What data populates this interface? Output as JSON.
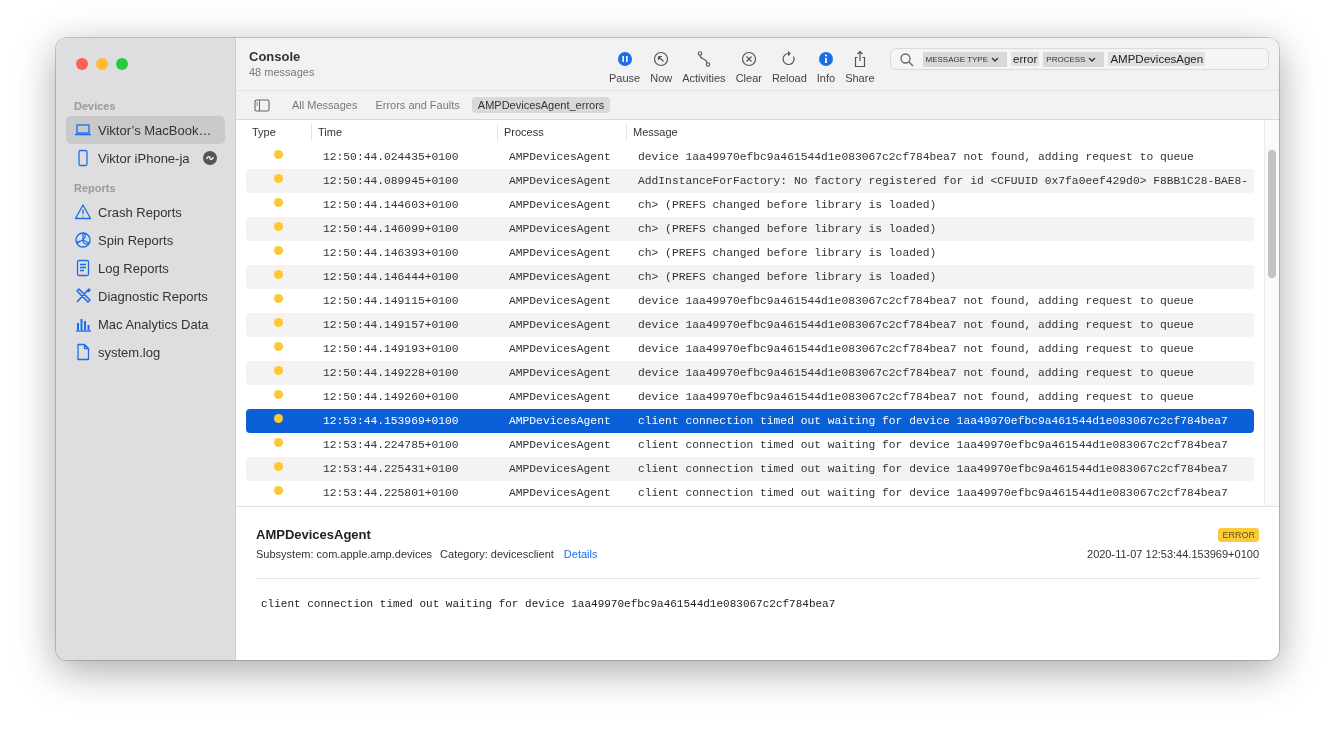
{
  "window": {
    "title": "Console",
    "subtitle": "48 messages"
  },
  "sidebar": {
    "sections": [
      {
        "heading": "Devices",
        "items": [
          {
            "label": "Viktor’s MacBook…",
            "kind": "laptop",
            "selected": true,
            "badge": false
          },
          {
            "label": "Viktor iPhone-ja",
            "kind": "phone",
            "selected": false,
            "badge": true
          }
        ]
      },
      {
        "heading": "Reports",
        "items": [
          {
            "label": "Crash Reports",
            "kind": "warning",
            "selected": false,
            "badge": false
          },
          {
            "label": "Spin Reports",
            "kind": "spin",
            "selected": false,
            "badge": false
          },
          {
            "label": "Log Reports",
            "kind": "doclines",
            "selected": false,
            "badge": false
          },
          {
            "label": "Diagnostic Reports",
            "kind": "tools",
            "selected": false,
            "badge": false
          },
          {
            "label": "Mac Analytics Data",
            "kind": "bars",
            "selected": false,
            "badge": false
          },
          {
            "label": "system.log",
            "kind": "doc",
            "selected": false,
            "badge": false
          }
        ]
      }
    ]
  },
  "toolbar": [
    {
      "label": "Pause",
      "kind": "pause"
    },
    {
      "label": "Now",
      "kind": "now"
    },
    {
      "label": "Activities",
      "kind": "activities"
    },
    {
      "label": "Clear",
      "kind": "clear"
    },
    {
      "label": "Reload",
      "kind": "reload"
    },
    {
      "label": "Info",
      "kind": "info"
    },
    {
      "label": "Share",
      "kind": "share"
    }
  ],
  "search": {
    "tokens": [
      {
        "key": "MESSAGE TYPE",
        "value": "error"
      },
      {
        "key": "PROCESS",
        "value": "AMPDevicesAgen"
      }
    ]
  },
  "tabs": [
    {
      "label": "All Messages",
      "selected": false
    },
    {
      "label": "Errors and Faults",
      "selected": false
    },
    {
      "label": "AMPDevicesAgent_errors",
      "selected": true
    }
  ],
  "table": {
    "columns": [
      "Type",
      "Time",
      "Process",
      "Message"
    ],
    "rows": [
      {
        "time": "12:50:44.024435+0100",
        "process": "AMPDevicesAgent",
        "message": "device 1aa49970efbc9a461544d1e083067c2cf784bea7 not found, adding request to queue",
        "selected": false
      },
      {
        "time": "12:50:44.089945+0100",
        "process": "AMPDevicesAgent",
        "message": "AddInstanceForFactory: No factory registered for id <CFUUID 0x7fa0eef429d0> F8BB1C28-BAE8-",
        "selected": false
      },
      {
        "time": "12:50:44.144603+0100",
        "process": "AMPDevicesAgent",
        "message": "ch> (PREFS changed before library is loaded)",
        "selected": false
      },
      {
        "time": "12:50:44.146099+0100",
        "process": "AMPDevicesAgent",
        "message": "ch> (PREFS changed before library is loaded)",
        "selected": false
      },
      {
        "time": "12:50:44.146393+0100",
        "process": "AMPDevicesAgent",
        "message": "ch> (PREFS changed before library is loaded)",
        "selected": false
      },
      {
        "time": "12:50:44.146444+0100",
        "process": "AMPDevicesAgent",
        "message": "ch> (PREFS changed before library is loaded)",
        "selected": false
      },
      {
        "time": "12:50:44.149115+0100",
        "process": "AMPDevicesAgent",
        "message": "device 1aa49970efbc9a461544d1e083067c2cf784bea7 not found, adding request to queue",
        "selected": false
      },
      {
        "time": "12:50:44.149157+0100",
        "process": "AMPDevicesAgent",
        "message": "device 1aa49970efbc9a461544d1e083067c2cf784bea7 not found, adding request to queue",
        "selected": false
      },
      {
        "time": "12:50:44.149193+0100",
        "process": "AMPDevicesAgent",
        "message": "device 1aa49970efbc9a461544d1e083067c2cf784bea7 not found, adding request to queue",
        "selected": false
      },
      {
        "time": "12:50:44.149228+0100",
        "process": "AMPDevicesAgent",
        "message": "device 1aa49970efbc9a461544d1e083067c2cf784bea7 not found, adding request to queue",
        "selected": false
      },
      {
        "time": "12:50:44.149260+0100",
        "process": "AMPDevicesAgent",
        "message": "device 1aa49970efbc9a461544d1e083067c2cf784bea7 not found, adding request to queue",
        "selected": false
      },
      {
        "time": "12:53:44.153969+0100",
        "process": "AMPDevicesAgent",
        "message": "client connection timed out waiting for device 1aa49970efbc9a461544d1e083067c2cf784bea7",
        "selected": true
      },
      {
        "time": "12:53:44.224785+0100",
        "process": "AMPDevicesAgent",
        "message": "client connection timed out waiting for device 1aa49970efbc9a461544d1e083067c2cf784bea7",
        "selected": false
      },
      {
        "time": "12:53:44.225431+0100",
        "process": "AMPDevicesAgent",
        "message": "client connection timed out waiting for device 1aa49970efbc9a461544d1e083067c2cf784bea7",
        "selected": false
      },
      {
        "time": "12:53:44.225801+0100",
        "process": "AMPDevicesAgent",
        "message": "client connection timed out waiting for device 1aa49970efbc9a461544d1e083067c2cf784bea7",
        "selected": false
      }
    ]
  },
  "detail": {
    "process": "AMPDevicesAgent",
    "subsystem": "Subsystem: com.apple.amp.devices",
    "category": "Category: devicesclient",
    "link": "Details",
    "badge": "ERROR",
    "timestamp": "2020-11-07 12:53:44.153969+0100",
    "message": "client connection timed out waiting for device 1aa49970efbc9a461544d1e083067c2cf784bea7"
  }
}
